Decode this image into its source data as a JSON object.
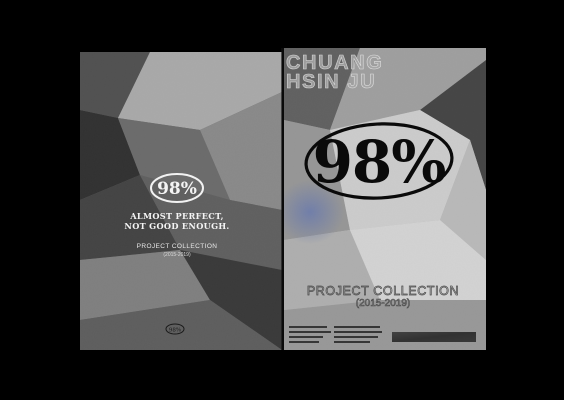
{
  "colors": {
    "background": "#000000",
    "paper_light": "#d8d8d8",
    "paper_mid": "#8c8c8c",
    "paper_dark": "#2a2a2a",
    "ink": "#0a0a0a",
    "accent_blue": "#5f6e9c"
  },
  "back_cover": {
    "badge_text": "98%",
    "tagline_line1": "ALMOST PERFECT,",
    "tagline_line2": "NOT GOOD ENOUGH.",
    "collection_title": "PROJECT COLLECTION",
    "collection_years": "(2015-2019)",
    "footer_badge_text": "98%"
  },
  "front_cover": {
    "name_line1": "CHUANG",
    "name_line2": "HSIN JU",
    "badge_text": "98%",
    "collection_title": "PROJECT COLLECTION",
    "collection_years": "(2015-2019)"
  }
}
